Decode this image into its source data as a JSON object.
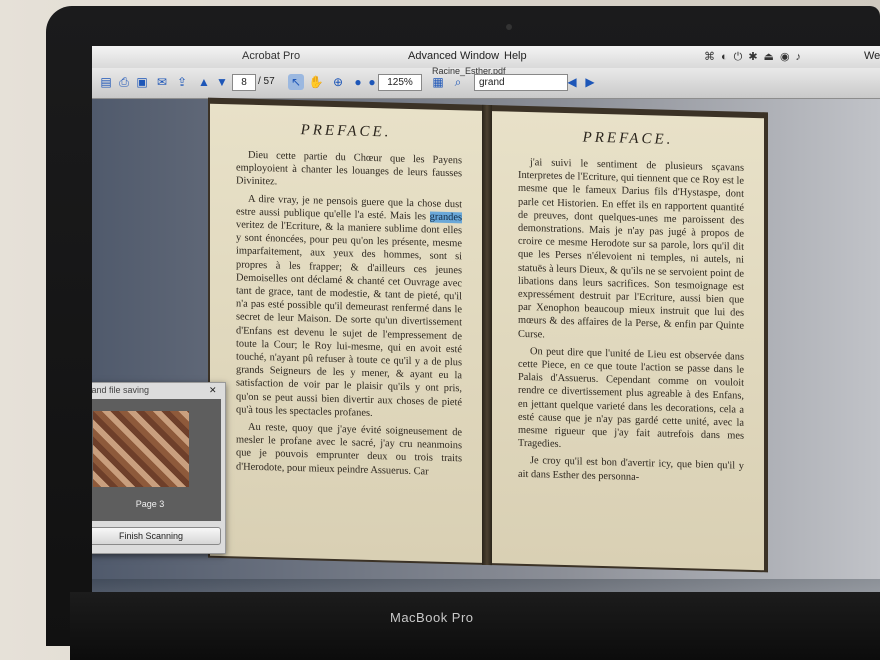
{
  "menubar": {
    "app_title": "Acrobat Pro",
    "menus": [
      "Advanced",
      "Window",
      "Help"
    ],
    "user": "Wer"
  },
  "toolbar": {
    "doc_title": "Racine_Esther.pdf",
    "page_current": "8",
    "page_total": "/ 57",
    "zoom": "125%",
    "search_value": "grand"
  },
  "document": {
    "left_page": {
      "heading": "PREFACE.",
      "paragraphs": [
        "Dieu cette partie du Chœur que les Payens employoient à chanter les louanges de leurs fausses Divinitez.",
        "A dire vray, je ne pensois guere que la chose dust estre aussi publique qu'elle l'a esté. Mais les [[grandes]] veritez de l'Ecriture, & la maniere sublime dont elles y sont énoncées, pour peu qu'on les présente, mesme imparfaitement, aux yeux des hommes, sont si propres à les frapper; & d'ailleurs ces jeunes Demoiselles ont déclamé & chanté cet Ouvrage avec tant de grace, tant de modestie, & tant de pieté, qu'il n'a pas esté possible qu'il demeurast renfermé dans le secret de leur Maison. De sorte qu'un divertissement d'Enfans est devenu le sujet de l'empressement de toute la Cour; le Roy lui-mesme, qui en avoit esté touché, n'ayant pû refuser à toute ce qu'il y a de plus grands Seigneurs de les y mener, & ayant eu la satisfaction de voir par le plaisir qu'ils y ont pris, qu'on se peut aussi bien divertir aux choses de pieté qu'à tous les spectacles profanes.",
        "Au reste, quoy que j'aye évité soigneusement de mesler le profane avec le sacré, j'ay cru neanmoins que je pouvois emprunter deux ou trois traits d'Herodote, pour mieux peindre Assuerus. Car"
      ]
    },
    "right_page": {
      "heading": "PREFACE.",
      "paragraphs": [
        "j'ai suivi le sentiment de plusieurs sçavans Interpretes de l'Ecriture, qui tiennent que ce Roy est le mesme que le fameux Darius fils d'Hystaspe, dont parle cet Historien. En effet ils en rapportent quantité de preuves, dont quelques-unes me paroissent des demonstrations. Mais je n'ay pas jugé à propos de croire ce mesme Herodote sur sa parole, lors qu'il dit que les Perses n'élevoient ni temples, ni autels, ni statuës à leurs Dieux, & qu'ils ne se servoient point de libations dans leurs sacrifices. Son tesmoignage est expressément destruit par l'Ecriture, aussi bien que par Xenophon beaucoup mieux instruit que lui des mœurs & des affaires de la Perse, & enfin par Quinte Curse.",
        "On peut dire que l'unité de Lieu est observée dans cette Piece, en ce que toute l'action se passe dans le Palais d'Assuerus. Cependant comme on vouloit rendre ce divertissement plus agreable à des Enfans, en jettant quelque varieté dans les decorations, cela a esté cause que je n'ay pas gardé cette unité, avec la mesme rigueur que j'ay fait autrefois dans mes Tragedies.",
        "Je croy qu'il est bon d'avertir icy, que bien qu'il y ait dans Esther des personna-"
      ]
    }
  },
  "scan_panel": {
    "title": "ng and file saving",
    "thumbnail_caption": "Page 3",
    "finish_button": "Finish Scanning"
  },
  "bezel": {
    "label": "MacBook Pro"
  },
  "dock_colors": [
    "#3a6fb0",
    "#9aa4b4",
    "#6a6a6a",
    "#d23a2a",
    "#2a5fb0",
    "#e0e0e0",
    "#7aa2d8",
    "#2a6ab0",
    "#8c6a4a",
    "#d2c23a",
    "#4aa04a",
    "#d23a6a",
    "#2a8ad0",
    "#e07a2a",
    "#3ab04a",
    "#a03ad0",
    "#d2d2d2",
    "#444444",
    "#2a9ae0",
    "#6a6aa0",
    "#e0d23a",
    "#2a2a2a",
    "#e06a2a",
    "#4aa0d0",
    "#6a6a6a",
    "#3a8ab0",
    "#d0d0d0",
    "#8a8a8a",
    "#2a6a9a",
    "#b0b0b0",
    "#3a3a3a"
  ]
}
